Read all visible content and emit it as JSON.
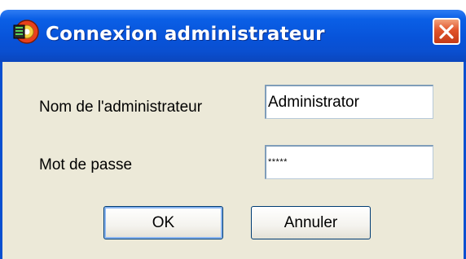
{
  "window": {
    "title": "Connexion administrateur",
    "app_icon": "application-icon",
    "close_icon": "close-icon"
  },
  "form": {
    "username_label": "Nom de l'administrateur",
    "username_value": "Administrator",
    "password_label": "Mot de passe",
    "password_value": "*****"
  },
  "buttons": {
    "ok_label": "OK",
    "cancel_label": "Annuler"
  },
  "colors": {
    "titlebar": "#0853d9",
    "dialog_background": "#ece9d8",
    "close_button": "#e1542b"
  }
}
